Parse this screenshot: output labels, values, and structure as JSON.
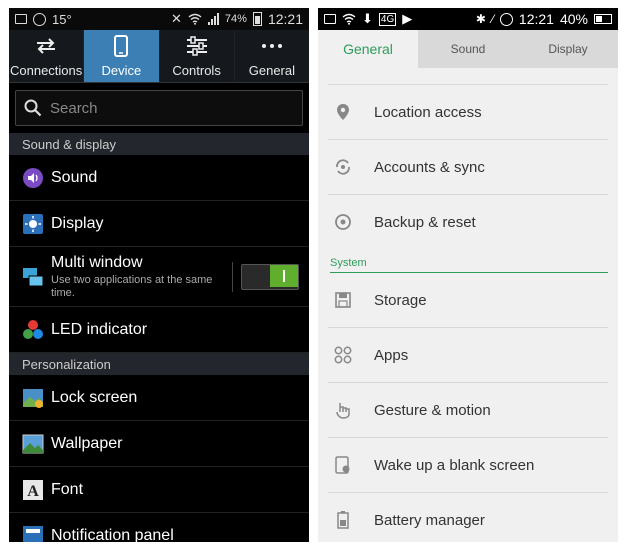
{
  "left": {
    "status": {
      "temp": "15°",
      "battery": "74%",
      "time": "12:21"
    },
    "tabs": [
      {
        "label": "Connections",
        "icon": "swap-arrows-icon"
      },
      {
        "label": "Device",
        "icon": "phone-icon"
      },
      {
        "label": "Controls",
        "icon": "sliders-icon"
      },
      {
        "label": "General",
        "icon": "more-dots-icon"
      }
    ],
    "search": {
      "placeholder": "Search"
    },
    "sections": [
      {
        "title": "Sound & display"
      },
      {
        "title": "Personalization"
      }
    ],
    "items": [
      {
        "label": "Sound",
        "icon": "sound-icon"
      },
      {
        "label": "Display",
        "icon": "display-icon"
      },
      {
        "label": "Multi window",
        "subtitle": "Use two applications at the same time.",
        "icon": "multi-window-icon",
        "toggle": true
      },
      {
        "label": "LED indicator",
        "icon": "led-indicator-icon"
      },
      {
        "label": "Lock screen",
        "icon": "lock-screen-icon"
      },
      {
        "label": "Wallpaper",
        "icon": "wallpaper-icon"
      },
      {
        "label": "Font",
        "icon": "font-icon"
      },
      {
        "label": "Notification panel",
        "icon": "notification-panel-icon"
      }
    ],
    "colors": {
      "accent": "#3b7fb4",
      "toggle_on": "#5fae2e"
    }
  },
  "right": {
    "status": {
      "time": "12:21",
      "battery": "40%",
      "badge": "4G"
    },
    "tabs": [
      {
        "label": "General"
      },
      {
        "label": "Sound"
      },
      {
        "label": "Display"
      }
    ],
    "items_top": [
      {
        "label": "Location access",
        "icon": "location-pin-icon"
      },
      {
        "label": "Accounts & sync",
        "icon": "sync-icon"
      },
      {
        "label": "Backup & reset",
        "icon": "backup-icon"
      }
    ],
    "section": "System",
    "items_system": [
      {
        "label": "Storage",
        "icon": "storage-icon"
      },
      {
        "label": "Apps",
        "icon": "apps-icon"
      },
      {
        "label": "Gesture & motion",
        "icon": "gesture-icon"
      },
      {
        "label": "Wake up a blank screen",
        "icon": "wake-screen-icon"
      },
      {
        "label": "Battery manager",
        "icon": "battery-icon"
      }
    ],
    "colors": {
      "accent": "#2e9c5b"
    }
  }
}
